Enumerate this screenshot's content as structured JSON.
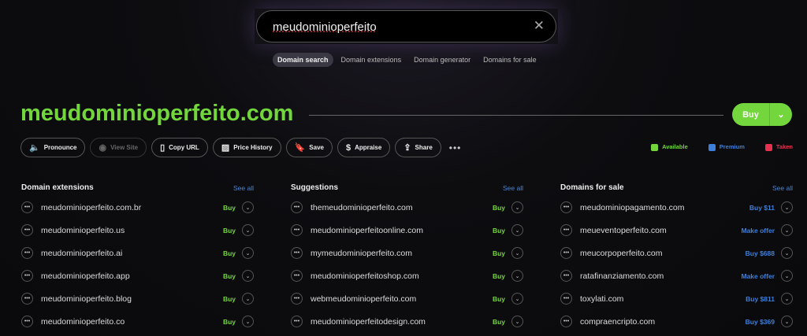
{
  "search": {
    "value": "meudominioperfeito",
    "clear": "✕"
  },
  "tabs": [
    {
      "label": "Domain search"
    },
    {
      "label": "Domain extensions"
    },
    {
      "label": "Domain generator"
    },
    {
      "label": "Domains for sale"
    }
  ],
  "domain": {
    "title": "meudominioperfeito.com",
    "buy": "Buy"
  },
  "actions": [
    {
      "label": "Pronounce",
      "icon": "🔈"
    },
    {
      "label": "View Site",
      "icon": "◉"
    },
    {
      "label": "Copy URL",
      "icon": "▯"
    },
    {
      "label": "Price History",
      "icon": "▨"
    },
    {
      "label": "Save",
      "icon": "🔖"
    },
    {
      "label": "Appraise",
      "icon": "$"
    },
    {
      "label": "Share",
      "icon": "⇪"
    }
  ],
  "legend": [
    {
      "label": "Available",
      "color": "#72d63c"
    },
    {
      "label": "Premium",
      "color": "#3d7fd9"
    },
    {
      "label": "Taken",
      "color": "#e8304f"
    }
  ],
  "columns": [
    {
      "title": "Domain extensions",
      "see_all": "See all",
      "rows": [
        {
          "name": "meudominioperfeito.com.br",
          "action": "Buy"
        },
        {
          "name": "meudominioperfeito.us",
          "action": "Buy"
        },
        {
          "name": "meudominioperfeito.ai",
          "action": "Buy"
        },
        {
          "name": "meudominioperfeito.app",
          "action": "Buy"
        },
        {
          "name": "meudominioperfeito.blog",
          "action": "Buy"
        },
        {
          "name": "meudominioperfeito.co",
          "action": "Buy"
        }
      ]
    },
    {
      "title": "Suggestions",
      "see_all": "See all",
      "rows": [
        {
          "name": "themeudominioperfeito.com",
          "action": "Buy"
        },
        {
          "name": "meudominioperfeitoonline.com",
          "action": "Buy"
        },
        {
          "name": "mymeudominioperfeito.com",
          "action": "Buy"
        },
        {
          "name": "meudominioperfeitoshop.com",
          "action": "Buy"
        },
        {
          "name": "webmeudominioperfeito.com",
          "action": "Buy"
        },
        {
          "name": "meudominioperfeitodesign.com",
          "action": "Buy"
        }
      ]
    },
    {
      "title": "Domains for sale",
      "see_all": "See all",
      "rows": [
        {
          "name": "meudominiopagamento.com",
          "action": "Buy $11"
        },
        {
          "name": "meueventoperfeito.com",
          "action": "Make offer"
        },
        {
          "name": "meucorpoperfeito.com",
          "action": "Buy $688"
        },
        {
          "name": "ratafinanziamento.com",
          "action": "Make offer"
        },
        {
          "name": "toxylati.com",
          "action": "Buy $811"
        },
        {
          "name": "compraencripto.com",
          "action": "Buy $369"
        }
      ]
    }
  ]
}
